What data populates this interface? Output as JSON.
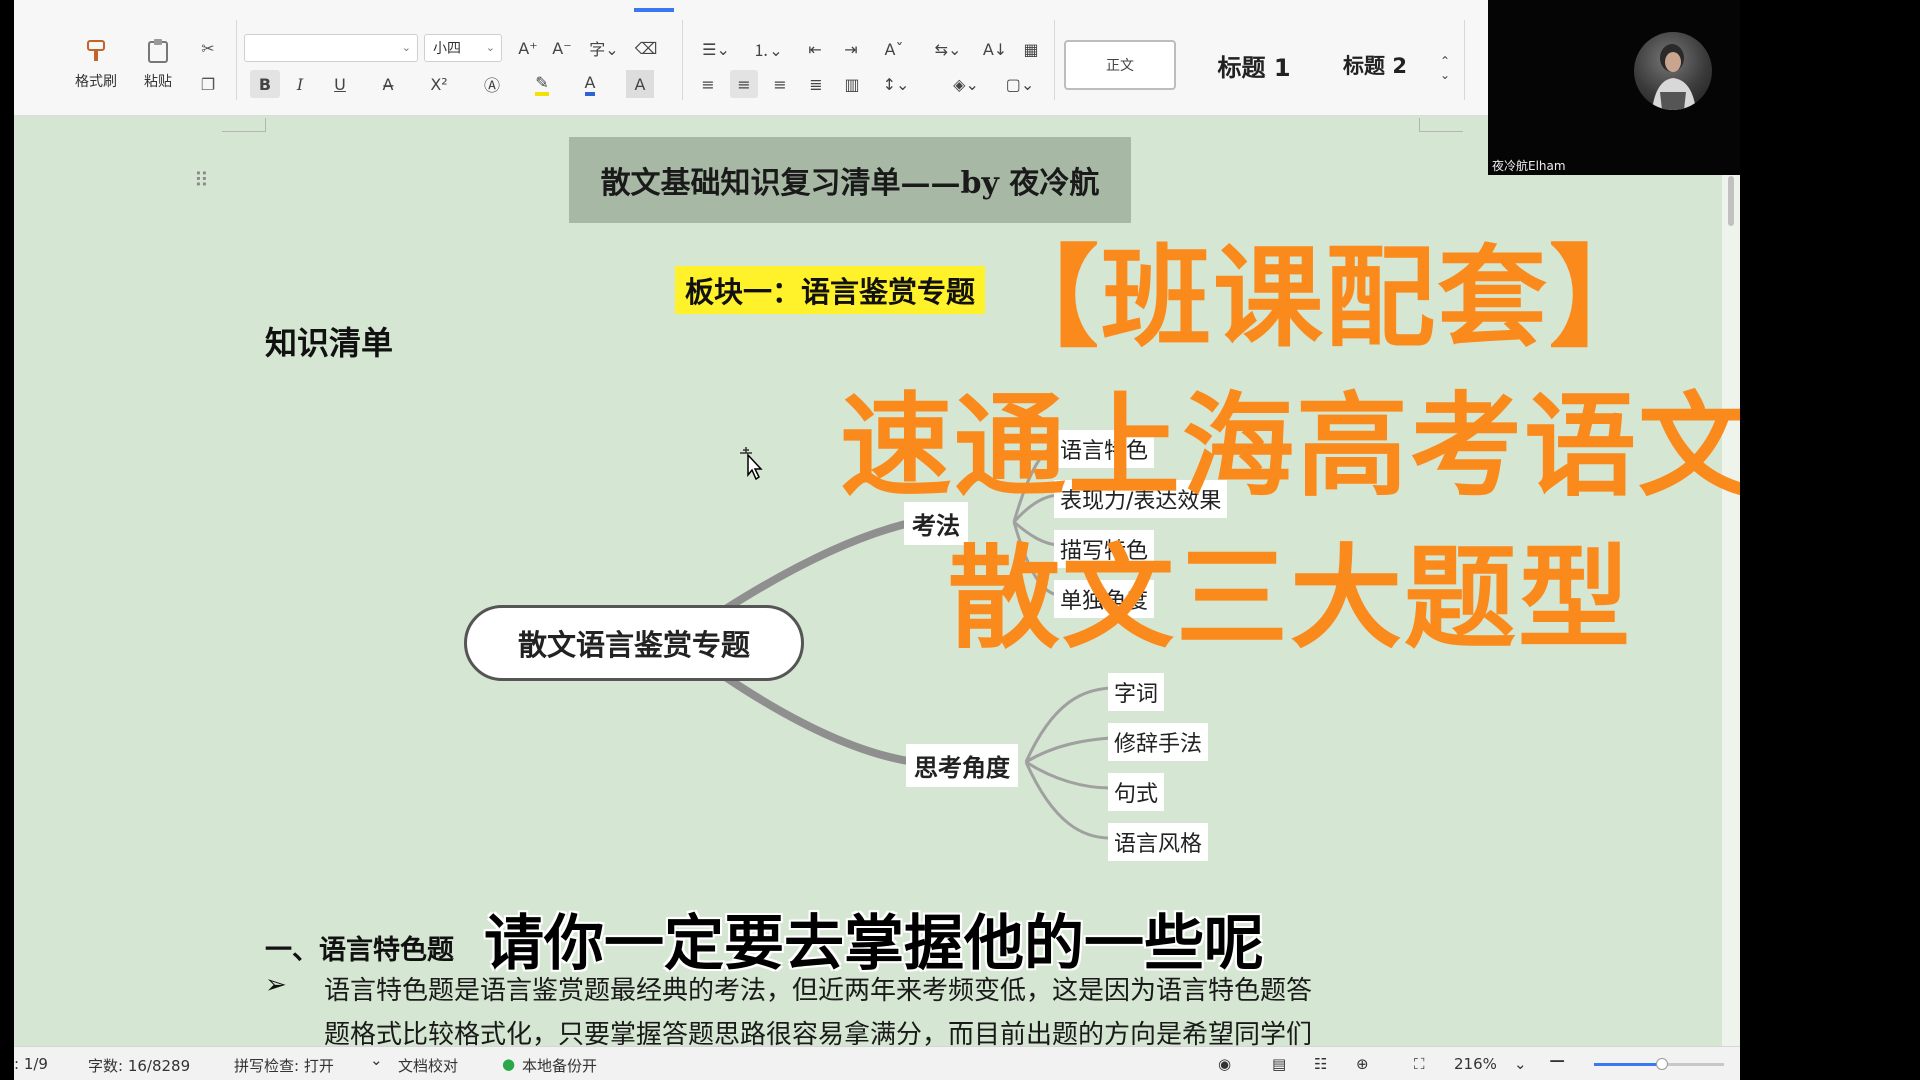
{
  "ribbon": {
    "format_painter": "格式刷",
    "paste": "粘贴",
    "font_size": "小四",
    "styles": {
      "normal": "正文",
      "heading1": "标题 1",
      "heading2": "标题 2"
    },
    "icons": [
      "format-painter-icon",
      "paste-icon",
      "cut-icon",
      "copy-icon",
      "bold-icon",
      "italic-icon",
      "underline-icon",
      "strikethrough-icon",
      "superscript-icon",
      "font-color-icon",
      "highlight-icon",
      "clear-format-icon",
      "bullet-list-icon",
      "numbered-list-icon",
      "indent-icon",
      "align-left-icon",
      "align-center-icon",
      "align-right-icon",
      "justify-icon",
      "line-spacing-icon",
      "shading-icon",
      "border-icon",
      "search-icon"
    ],
    "labels": {
      "bold": "B",
      "italic": "I",
      "underline": "U",
      "superscript": "X²",
      "font_a": "A",
      "grow": "A⁺",
      "shrink": "A⁻"
    }
  },
  "document": {
    "title": "散文基础知识复习清单——by 夜冷航",
    "block_heading": "板块一：语言鉴赏专题",
    "knowledge": "知识清单",
    "mindmap": {
      "root": "散文语言鉴赏专题",
      "branches": [
        {
          "label": "考法",
          "children": [
            "语言特色",
            "表现力/表达效果",
            "描写特色",
            "单独角度"
          ]
        },
        {
          "label": "思考角度",
          "children": [
            "字词",
            "修辞手法",
            "句式",
            "语言风格"
          ]
        }
      ]
    },
    "section_heading": "一、语言特色题",
    "bullet": "➢",
    "paragraph_line1": "语言特色题是语言鉴赏题最经典的考法，但近两年来考频变低，这是因为语言特色题答",
    "paragraph_line2": "题格式比较格式化，只要掌握答题思路很容易拿满分，而目前出题的方向是希望同学们"
  },
  "overlay": {
    "line1": "【班课配套】",
    "line2": "速通上海高考语文",
    "line3": "散文三大题型",
    "subtitle": "请你一定要去掌握他的一些呢",
    "color": "#fb8a1c"
  },
  "status": {
    "page": ": 1/9",
    "word_count": "字数: 16/8289",
    "spell_check": "拼写检查: 打开",
    "proofread": "文档校对",
    "backup": "本地备份开",
    "zoom": "216%",
    "zoom_fraction": 0.52
  },
  "webcam": {
    "name": "夜冷航Elham"
  },
  "colors": {
    "doc_bg": "#d5e6d2",
    "title_bg": "#a7b9a5",
    "highlight": "#fff12a",
    "accent": "#3a78f2"
  }
}
